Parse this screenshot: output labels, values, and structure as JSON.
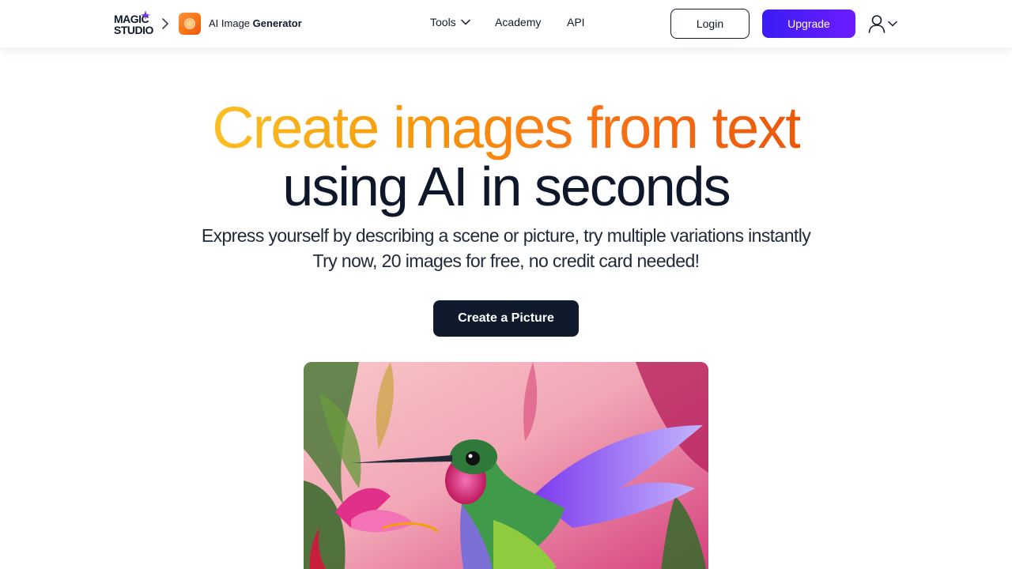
{
  "brand": {
    "logo_line1": "MAGIC",
    "logo_line2": "STUDIO",
    "app_name_prefix": "AI Image",
    "app_name_bold": "Generator",
    "logo_accent": "#7c3aed"
  },
  "nav": {
    "tools_label": "Tools",
    "academy_label": "Academy",
    "api_label": "API"
  },
  "header_actions": {
    "login_label": "Login",
    "upgrade_label": "Upgrade",
    "upgrade_gradient": [
      "#3b1cf5",
      "#6d1cff"
    ]
  },
  "hero": {
    "title_highlight": "Create images from text",
    "title_rest": "using AI in seconds",
    "subtitle_line1": "Express yourself by describing a scene or picture, try multiple variations instantly",
    "subtitle_line2": "Try now, 20 images for free, no credit card needed!",
    "cta_label": "Create a Picture",
    "highlight_gradient": [
      "#fbbf24",
      "#ea580c"
    ]
  },
  "showcase": {
    "image_alt": "hummingbird-painting",
    "icon": "hummingbird-illustration"
  }
}
